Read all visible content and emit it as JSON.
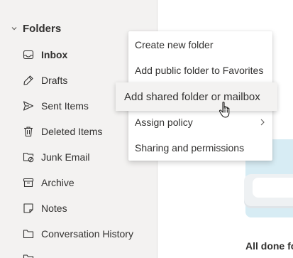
{
  "folders": {
    "header_label": "Folders",
    "items": [
      {
        "label": "Inbox",
        "icon": "inbox-icon",
        "selected": true
      },
      {
        "label": "Drafts",
        "icon": "drafts-icon"
      },
      {
        "label": "Sent Items",
        "icon": "sent-icon"
      },
      {
        "label": "Deleted Items",
        "icon": "trash-icon"
      },
      {
        "label": "Junk Email",
        "icon": "junk-folder-icon"
      },
      {
        "label": "Archive",
        "icon": "archive-icon"
      },
      {
        "label": "Notes",
        "icon": "notes-icon"
      },
      {
        "label": "Conversation History",
        "icon": "folder-icon"
      }
    ]
  },
  "context_menu": {
    "items": [
      {
        "label": "Create new folder"
      },
      {
        "label": "Add public folder to Favorites"
      },
      {
        "label": "Add shared folder or mailbox",
        "hovered": true
      },
      {
        "label": "Assign policy",
        "has_submenu": true
      },
      {
        "label": "Sharing and permissions"
      }
    ]
  },
  "reading_pane": {
    "status_text": "All done fo"
  },
  "colors": {
    "pane_bg": "#f3f2f1",
    "text": "#323130",
    "hover_bg": "#f3f2f1"
  }
}
